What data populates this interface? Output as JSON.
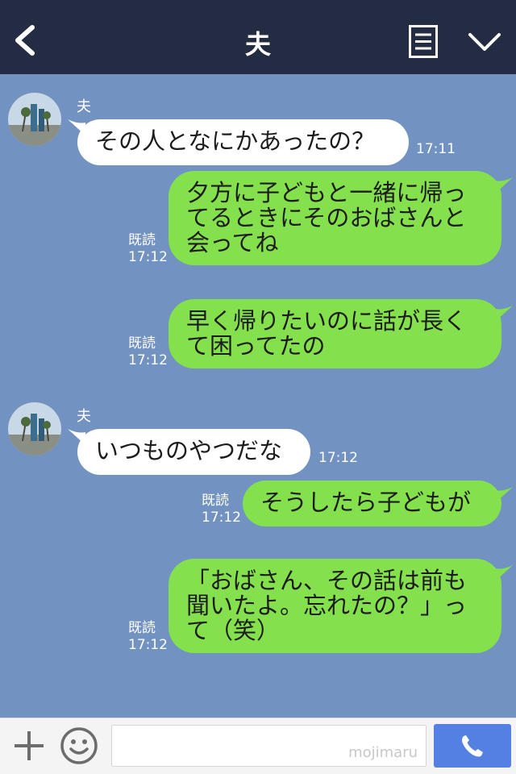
{
  "header": {
    "back_icon": "chevron-left-icon",
    "title": "夫",
    "menu_icon": "list-icon",
    "collapse_icon": "chevron-down-icon"
  },
  "messages": [
    {
      "direction": "incoming",
      "sender": "夫",
      "text": "その人となにかあったの？",
      "time": "17:11"
    },
    {
      "direction": "outgoing",
      "lines": [
        "夕方に子どもと一緒に帰っ",
        "てるときにそのおばさんと",
        "会ってね"
      ],
      "read": "既読",
      "time": "17:12"
    },
    {
      "direction": "outgoing",
      "lines": [
        "早く帰りたいのに話が長く",
        "て困ってたの"
      ],
      "read": "既読",
      "time": "17:12"
    },
    {
      "direction": "incoming",
      "sender": "夫",
      "text": "いつものやつだな",
      "time": "17:12"
    },
    {
      "direction": "outgoing",
      "text": "そうしたら子どもが",
      "read": "既読",
      "time": "17:12"
    },
    {
      "direction": "outgoing",
      "lines": [
        "「おばさん、その話は前も",
        "聞いたよ。忘れたの？」っ",
        "て（笑）"
      ],
      "read": "既読",
      "time": "17:12"
    }
  ],
  "footer": {
    "add_icon": "plus-icon",
    "emoji_icon": "smile-icon",
    "input_value": "",
    "watermark": "mojimaru",
    "call_icon": "phone-icon"
  },
  "colors": {
    "header_bg": "#232c42",
    "chat_bg": "#7292c2",
    "incoming_bubble": "#ffffff",
    "outgoing_bubble": "#84e04c",
    "call_button": "#5580e3"
  }
}
